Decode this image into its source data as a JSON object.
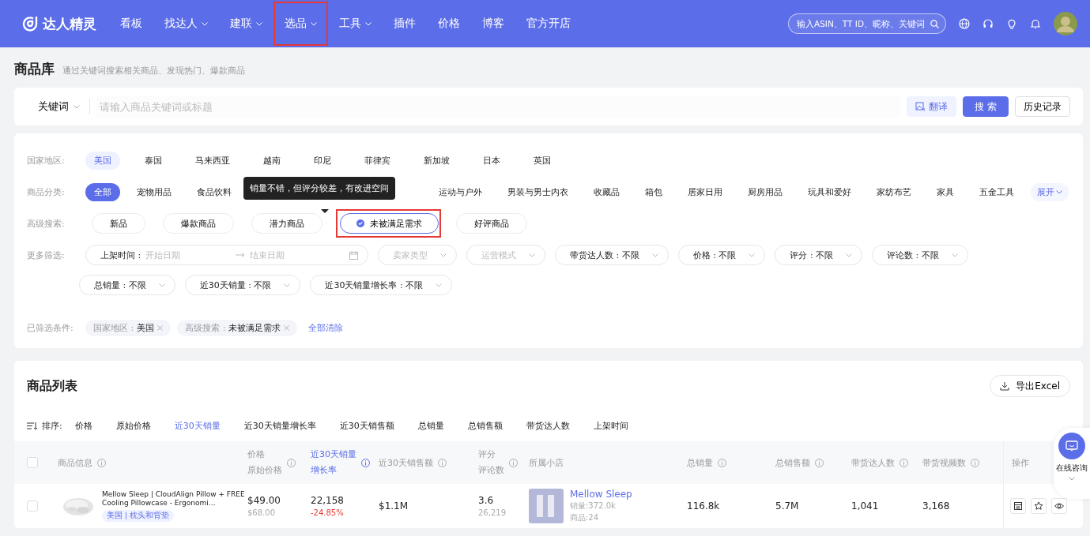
{
  "nav": {
    "brand": "达人精灵",
    "items": [
      {
        "label": "看板",
        "dropdown": false,
        "highlighted": false
      },
      {
        "label": "找达人",
        "dropdown": true,
        "highlighted": false
      },
      {
        "label": "建联",
        "dropdown": true,
        "highlighted": false
      },
      {
        "label": "选品",
        "dropdown": true,
        "highlighted": true
      },
      {
        "label": "工具",
        "dropdown": true,
        "highlighted": false
      },
      {
        "label": "插件",
        "dropdown": false,
        "highlighted": false
      },
      {
        "label": "价格",
        "dropdown": false,
        "highlighted": false
      },
      {
        "label": "博客",
        "dropdown": false,
        "highlighted": false
      },
      {
        "label": "官方开店",
        "dropdown": false,
        "highlighted": false
      }
    ],
    "search_placeholder": "输入ASIN、TT ID、昵称、关键词"
  },
  "page": {
    "title": "商品库",
    "subtitle": "通过关键词搜索相关商品、发现热门、爆款商品"
  },
  "search": {
    "mode": "关键词",
    "placeholder": "请输入商品关键词或标题",
    "translate": "翻译",
    "submit": "搜 索",
    "history": "历史记录"
  },
  "filters": {
    "region": {
      "label": "国家地区:",
      "options": [
        {
          "label": "美国",
          "selected": true
        },
        {
          "label": "泰国",
          "selected": false
        },
        {
          "label": "马来西亚",
          "selected": false
        },
        {
          "label": "越南",
          "selected": false
        },
        {
          "label": "印尼",
          "selected": false
        },
        {
          "label": "菲律宾",
          "selected": false
        },
        {
          "label": "新加坡",
          "selected": false
        },
        {
          "label": "日本",
          "selected": false
        },
        {
          "label": "英国",
          "selected": false
        }
      ]
    },
    "category": {
      "label": "商品分类:",
      "options": [
        {
          "label": "全部",
          "selected": true
        },
        {
          "label": "宠物用品",
          "selected": false
        },
        {
          "label": "食品饮料",
          "selected": false
        },
        {
          "label": "运动与户外",
          "selected": false
        },
        {
          "label": "男装与男士内衣",
          "selected": false
        },
        {
          "label": "收藏品",
          "selected": false
        },
        {
          "label": "箱包",
          "selected": false
        },
        {
          "label": "居家日用",
          "selected": false
        },
        {
          "label": "厨房用品",
          "selected": false
        },
        {
          "label": "玩具和爱好",
          "selected": false
        },
        {
          "label": "家纺布艺",
          "selected": false
        },
        {
          "label": "家具",
          "selected": false
        },
        {
          "label": "五金工具",
          "selected": false
        }
      ],
      "expand": "展开"
    },
    "advanced": {
      "label": "高级搜索:",
      "options": [
        {
          "label": "新品",
          "selected": false,
          "highlighted": false
        },
        {
          "label": "爆款商品",
          "selected": false,
          "highlighted": false
        },
        {
          "label": "潜力商品",
          "selected": false,
          "highlighted": false
        },
        {
          "label": "未被满足需求",
          "selected": true,
          "highlighted": true
        },
        {
          "label": "好评商品",
          "selected": false,
          "highlighted": false
        }
      ],
      "tooltip": "销量不错，但评分较差，有改进空间"
    },
    "more": {
      "label": "更多筛选:",
      "date": {
        "label": "上架时间 :",
        "start": "开始日期",
        "end": "结束日期"
      },
      "dropdowns": [
        {
          "label": "卖家类型",
          "disabled": true
        },
        {
          "label": "运营模式",
          "disabled": true
        },
        {
          "label": "带货达人数 : 不限",
          "disabled": false
        },
        {
          "label": "价格 : 不限",
          "disabled": false
        },
        {
          "label": "评分 : 不限",
          "disabled": false
        },
        {
          "label": "评论数 : 不限",
          "disabled": false
        },
        {
          "label": "总销量 : 不限",
          "disabled": false
        },
        {
          "label": "近30天销量 : 不限",
          "disabled": false
        },
        {
          "label": "近30天销量增长率 : 不限",
          "disabled": false
        }
      ]
    },
    "applied": {
      "label": "已筛选条件:",
      "chips": [
        {
          "key": "国家地区 :",
          "value": "美国"
        },
        {
          "key": "高级搜索 :",
          "value": "未被满足需求"
        }
      ],
      "clear": "全部清除"
    }
  },
  "list": {
    "title": "商品列表",
    "select_all_checked": false,
    "export": "导出Excel",
    "sort_label": "排序:",
    "sorts": [
      {
        "label": "价格",
        "selected": false
      },
      {
        "label": "原始价格",
        "selected": false
      },
      {
        "label": "近30天销量",
        "selected": true
      },
      {
        "label": "近30天销量增长率",
        "selected": false
      },
      {
        "label": "近30天销售额",
        "selected": false
      },
      {
        "label": "总销量",
        "selected": false
      },
      {
        "label": "总销售额",
        "selected": false
      },
      {
        "label": "带货达人数",
        "selected": false
      },
      {
        "label": "上架时间",
        "selected": false
      }
    ],
    "columns": [
      {
        "lines": [
          "商品信息"
        ],
        "info": true,
        "selected": false
      },
      {
        "lines": [
          "价格",
          "原始价格"
        ],
        "info": true,
        "selected": false
      },
      {
        "lines": [
          "近30天销量",
          "增长率"
        ],
        "info": true,
        "selected": true
      },
      {
        "lines": [
          "近30天销售额"
        ],
        "info": true,
        "selected": false
      },
      {
        "lines": [
          "评分",
          "评论数"
        ],
        "info": true,
        "selected": false
      },
      {
        "lines": [
          "所属小店"
        ],
        "info": false,
        "selected": false
      },
      {
        "lines": [
          "总销量"
        ],
        "info": true,
        "selected": false
      },
      {
        "lines": [
          "总销售额"
        ],
        "info": true,
        "selected": false
      },
      {
        "lines": [
          "带货达人数"
        ],
        "info": true,
        "selected": false
      },
      {
        "lines": [
          "带货视频数"
        ],
        "info": true,
        "selected": false
      },
      {
        "lines": [
          "操作"
        ],
        "info": false,
        "selected": false
      }
    ],
    "rows": [
      {
        "checked": false,
        "title": "Mellow Sleep | CloudAlign Pillow + FREE Cooling Pillowcase - Ergonomi…",
        "tag": "美国 | 枕头和背垫",
        "price": "$49.00",
        "original_price": "$68.00",
        "sales_30d": "22,158",
        "growth": "-24.85%",
        "revenue_30d": "$1.1M",
        "rating": "3.6",
        "reviews": "26,219",
        "shop": {
          "name": "Mellow Sleep",
          "sales": "销量:372.0k",
          "products": "商品:24"
        },
        "total_sales": "116.8k",
        "total_revenue": "5.7M",
        "creators": "1,041",
        "videos": "3,168"
      }
    ]
  },
  "chat": {
    "label": "在线咨询"
  }
}
